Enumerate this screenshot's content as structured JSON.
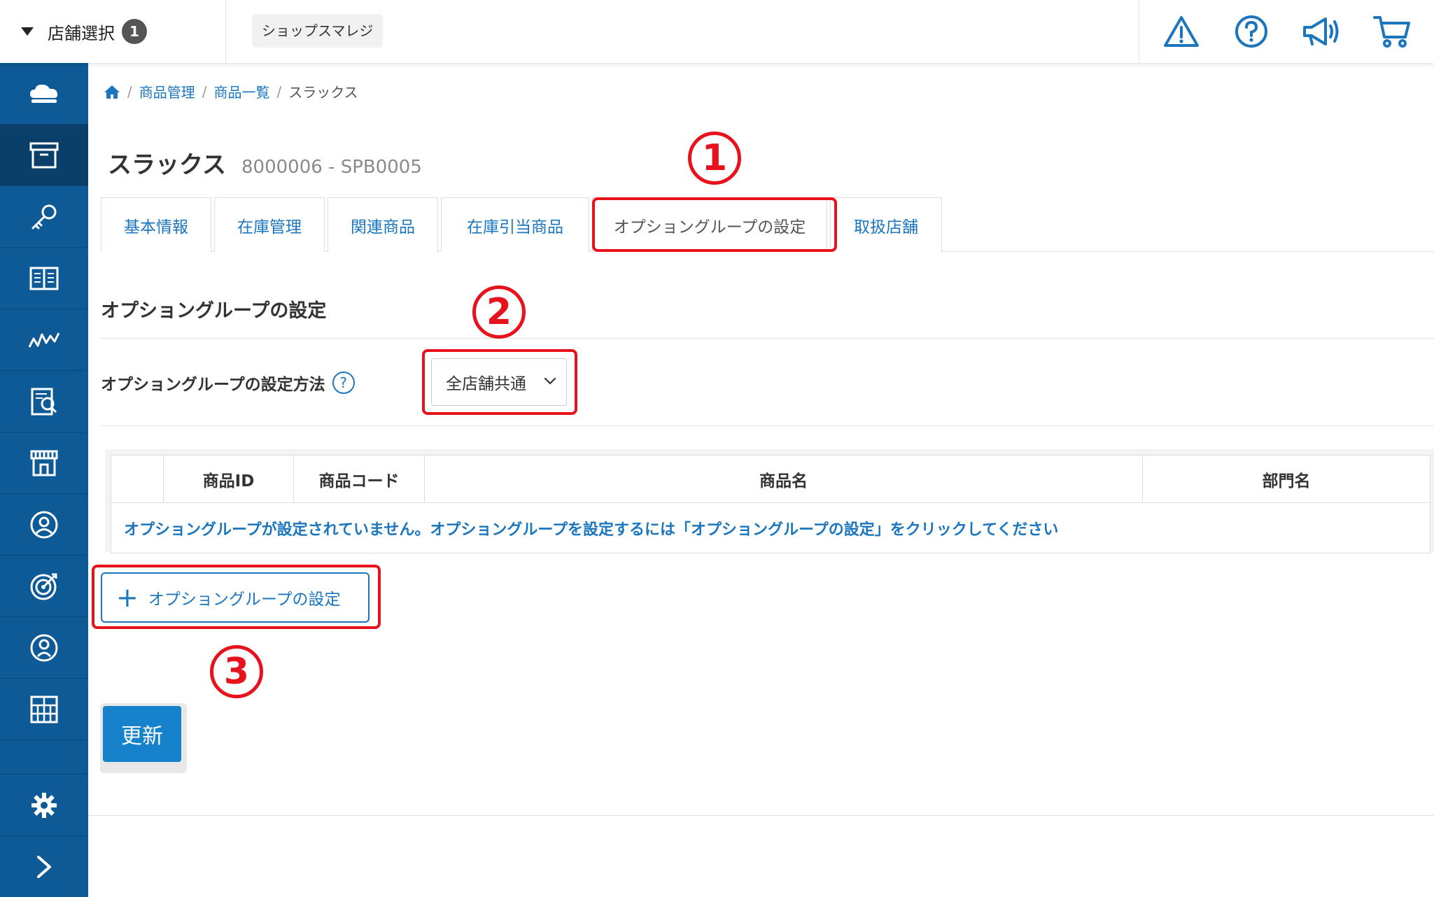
{
  "topbar": {
    "store_select_label": "店舗選択",
    "store_count": "1",
    "shop_name": "ショップスマレジ",
    "icons": [
      "warning-icon",
      "help-icon",
      "megaphone-icon",
      "cart-icon"
    ]
  },
  "sidebar": {
    "items": [
      "cloud-icon",
      "box-icon",
      "key-icon",
      "book-icon",
      "chart-icon",
      "report-icon",
      "store-icon",
      "member-icon",
      "target-icon",
      "user-icon",
      "grid-icon"
    ],
    "bottom": [
      "gear-icon",
      "chevron-right-icon"
    ]
  },
  "breadcrumb": {
    "items": [
      "商品管理",
      "商品一覧"
    ],
    "current": "スラックス",
    "sep": "/"
  },
  "page": {
    "title": "スラックス",
    "code": "8000006 - SPB0005"
  },
  "tabs": [
    "基本情報",
    "在庫管理",
    "関連商品",
    "在庫引当商品",
    "オプショングループの設定",
    "取扱店舗"
  ],
  "section": {
    "title": "オプショングループの設定",
    "method_label": "オプショングループの設定方法",
    "help": "?",
    "method_value": "全店舗共通"
  },
  "table": {
    "headers": [
      "",
      "商品ID",
      "商品コード",
      "商品名",
      "部門名"
    ],
    "empty_message": "オプショングループが設定されていません。オプショングループを設定するには「オプショングループの設定」をクリックしてください"
  },
  "buttons": {
    "add_label": "オプショングループの設定",
    "update_label": "更新"
  },
  "annotations": {
    "markers": [
      "1",
      "2",
      "3"
    ],
    "color": "#e8121c"
  }
}
